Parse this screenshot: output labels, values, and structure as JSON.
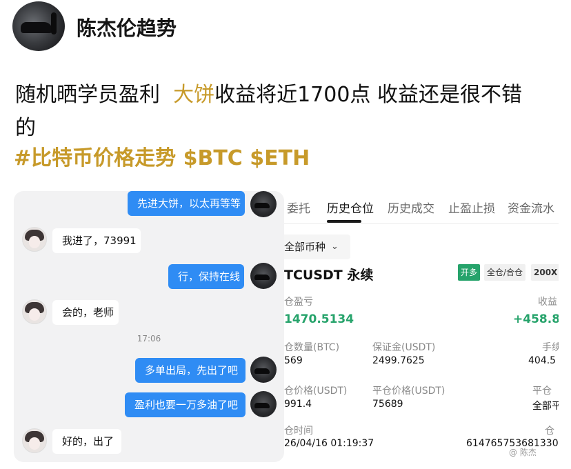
{
  "header": {
    "username": "陈杰伦趋势"
  },
  "post": {
    "line1_prefix": "随机晒学员盈利",
    "line1_highlight": "大饼",
    "line1_suffix": "收益将近1700点 收益还是很不错",
    "line2": "的",
    "hashtags": "#比特币价格走势 $BTC $ETH"
  },
  "chat": {
    "messages": [
      {
        "side": "right",
        "text": "先进大饼，以太再等等"
      },
      {
        "side": "left",
        "text": "我进了，73991"
      },
      {
        "side": "right",
        "text": "行，保持在线"
      },
      {
        "side": "left",
        "text": "会的，老师"
      },
      {
        "side": "right",
        "text": "多单出局，先出了吧"
      },
      {
        "side": "right",
        "text": "盈利也要一万多油了吧"
      },
      {
        "side": "left",
        "text": "好的，出了"
      }
    ],
    "timestamp": "17:06"
  },
  "trade": {
    "tabs": [
      "委托",
      "历史仓位",
      "历史成交",
      "止盈止损",
      "资金流水"
    ],
    "active_tab": "历史仓位",
    "filter": "全部币种",
    "symbol": "TCUSDT 永续",
    "tags": {
      "side": "开多",
      "margin": "全仓/合仓",
      "leverage": "200X"
    },
    "pnl_label": "仓盈亏",
    "pnl_value": "1470.5134",
    "yield_label": "收益",
    "yield_value": "+458.8",
    "qty_label": "仓数量(BTC)",
    "qty_value": "569",
    "margin_label": "保证金(USDT)",
    "margin_value": "2499.7625",
    "fee_label": "手续",
    "fee_value": "404.5",
    "open_label": "仓价格(USDT)",
    "open_value": "991.4",
    "close_label": "平仓价格(USDT)",
    "close_value": "75689",
    "closetype_label": "平仓",
    "closetype_value": "全部平",
    "time_label": "仓时间",
    "time_value": "26/04/16 01:19:37",
    "id_label": "仓",
    "id_value": "614765753681330",
    "watermark": "@ 陈杰"
  }
}
